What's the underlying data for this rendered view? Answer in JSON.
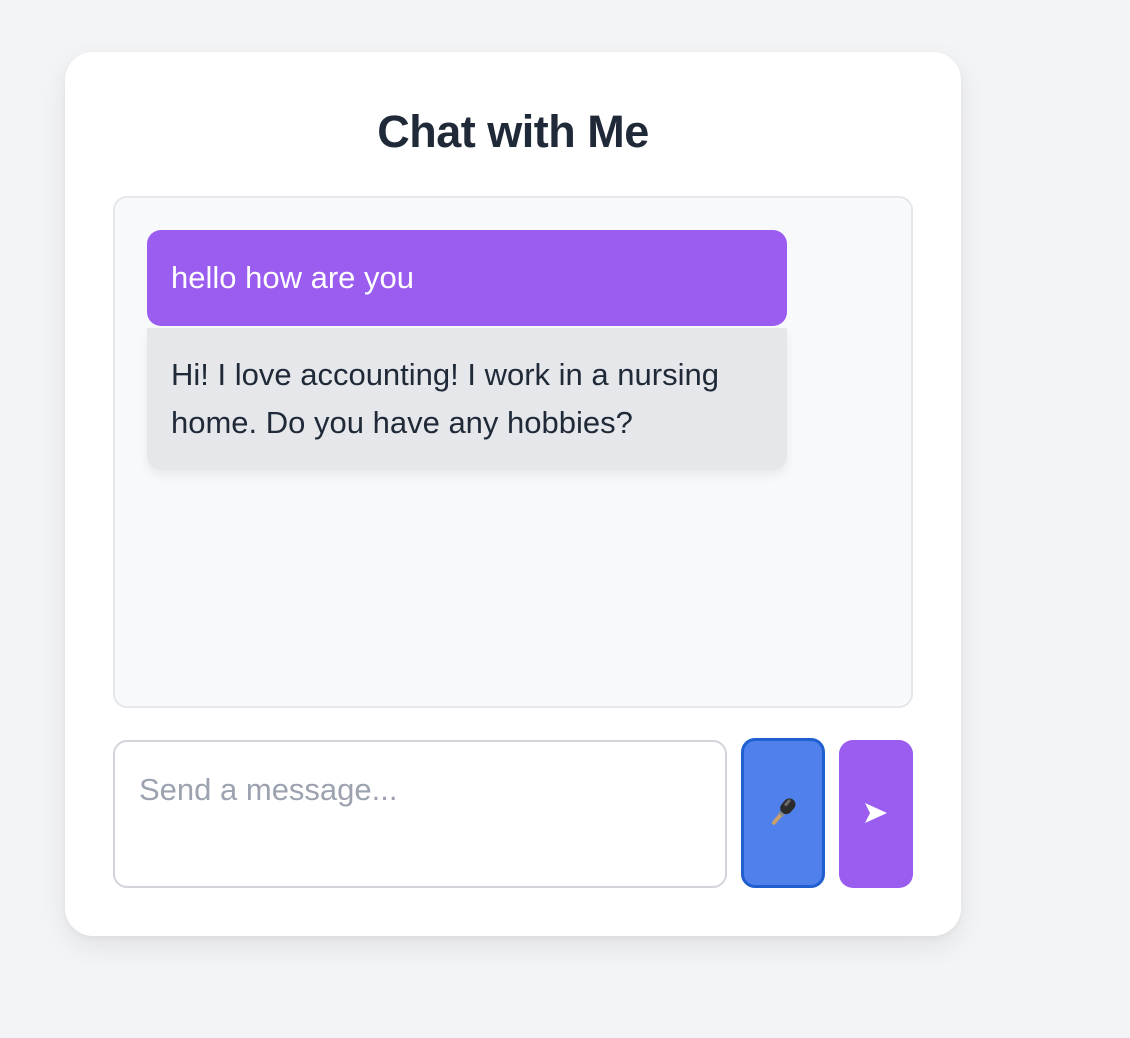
{
  "header": {
    "title": "Chat with Me"
  },
  "messages": [
    {
      "role": "user",
      "text": "hello how are you"
    },
    {
      "role": "bot",
      "text": "Hi! I love accounting! I work in a nursing home. Do you have any hobbies?"
    }
  ],
  "composer": {
    "placeholder": "Send a message...",
    "value": "",
    "mic_icon": "microphone-icon",
    "send_icon": "send-arrow-icon"
  },
  "colors": {
    "accent": "#9b5cf0",
    "mic_button": "#4f80ec",
    "bot_bubble": "#e5e7eb",
    "page_background": "#f3f4f6"
  }
}
